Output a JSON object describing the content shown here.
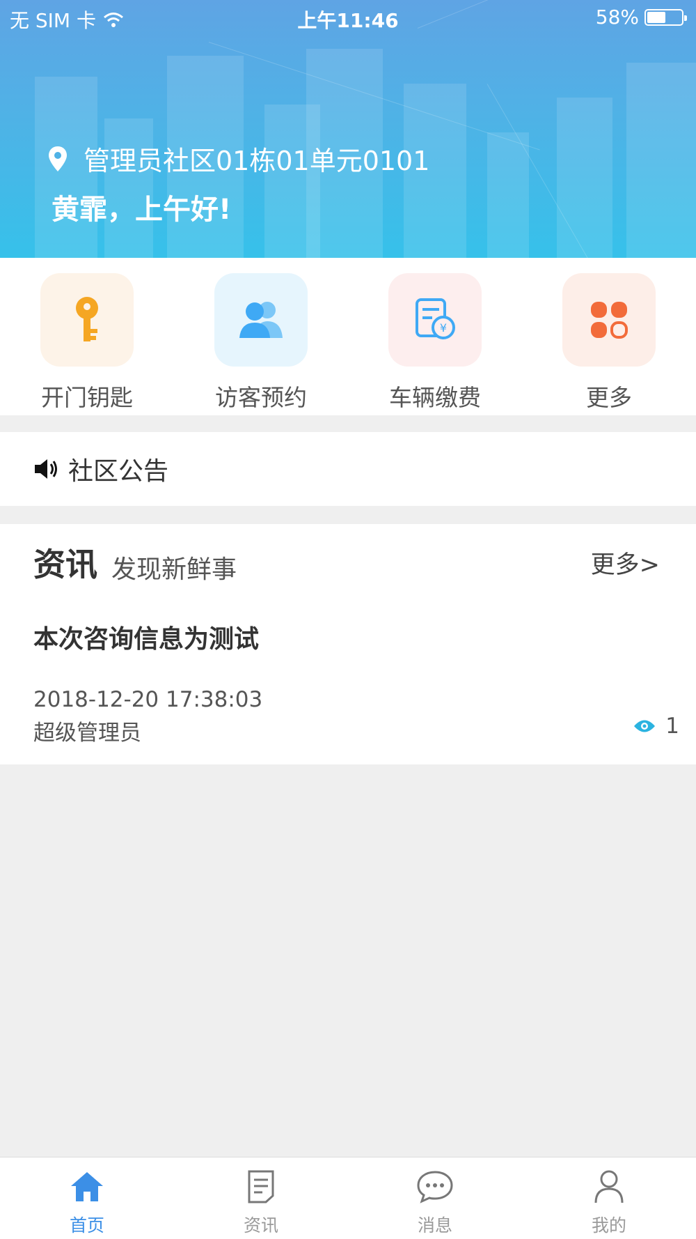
{
  "status_bar": {
    "carrier": "无 SIM 卡",
    "time": "上午11:46",
    "battery": "58%",
    "battery_level": 0.58
  },
  "header": {
    "address": "管理员社区01栋01单元0101",
    "greeting": "黄霏，上午好!"
  },
  "quick_actions": [
    {
      "label": "开门钥匙",
      "icon": "key-icon",
      "bg": "#fdf3e8",
      "color": "#f5a623"
    },
    {
      "label": "访客预约",
      "icon": "visitors-icon",
      "bg": "#e6f5fd",
      "color": "#3fa9f5"
    },
    {
      "label": "车辆缴费",
      "icon": "bill-icon",
      "bg": "#fdeeee",
      "color": "#3fa9f5"
    },
    {
      "label": "更多",
      "icon": "grid-icon",
      "bg": "#fdeee8",
      "color": "#f26b3a"
    }
  ],
  "notice": {
    "label": "社区公告"
  },
  "news": {
    "title": "资讯",
    "subtitle": "发现新鲜事",
    "more": "更多>",
    "article": {
      "title": "本次咨询信息为测试",
      "date": "2018-12-20 17:38:03",
      "author": "超级管理员",
      "views": "1"
    }
  },
  "tabs": [
    {
      "label": "首页",
      "icon": "home-icon",
      "active": true
    },
    {
      "label": "资讯",
      "icon": "document-icon",
      "active": false
    },
    {
      "label": "消息",
      "icon": "chat-icon",
      "active": false
    },
    {
      "label": "我的",
      "icon": "user-icon",
      "active": false
    }
  ],
  "colors": {
    "accent": "#3c8fe6",
    "header_top": "#5fa4e4",
    "header_bottom": "#36c1ea"
  }
}
